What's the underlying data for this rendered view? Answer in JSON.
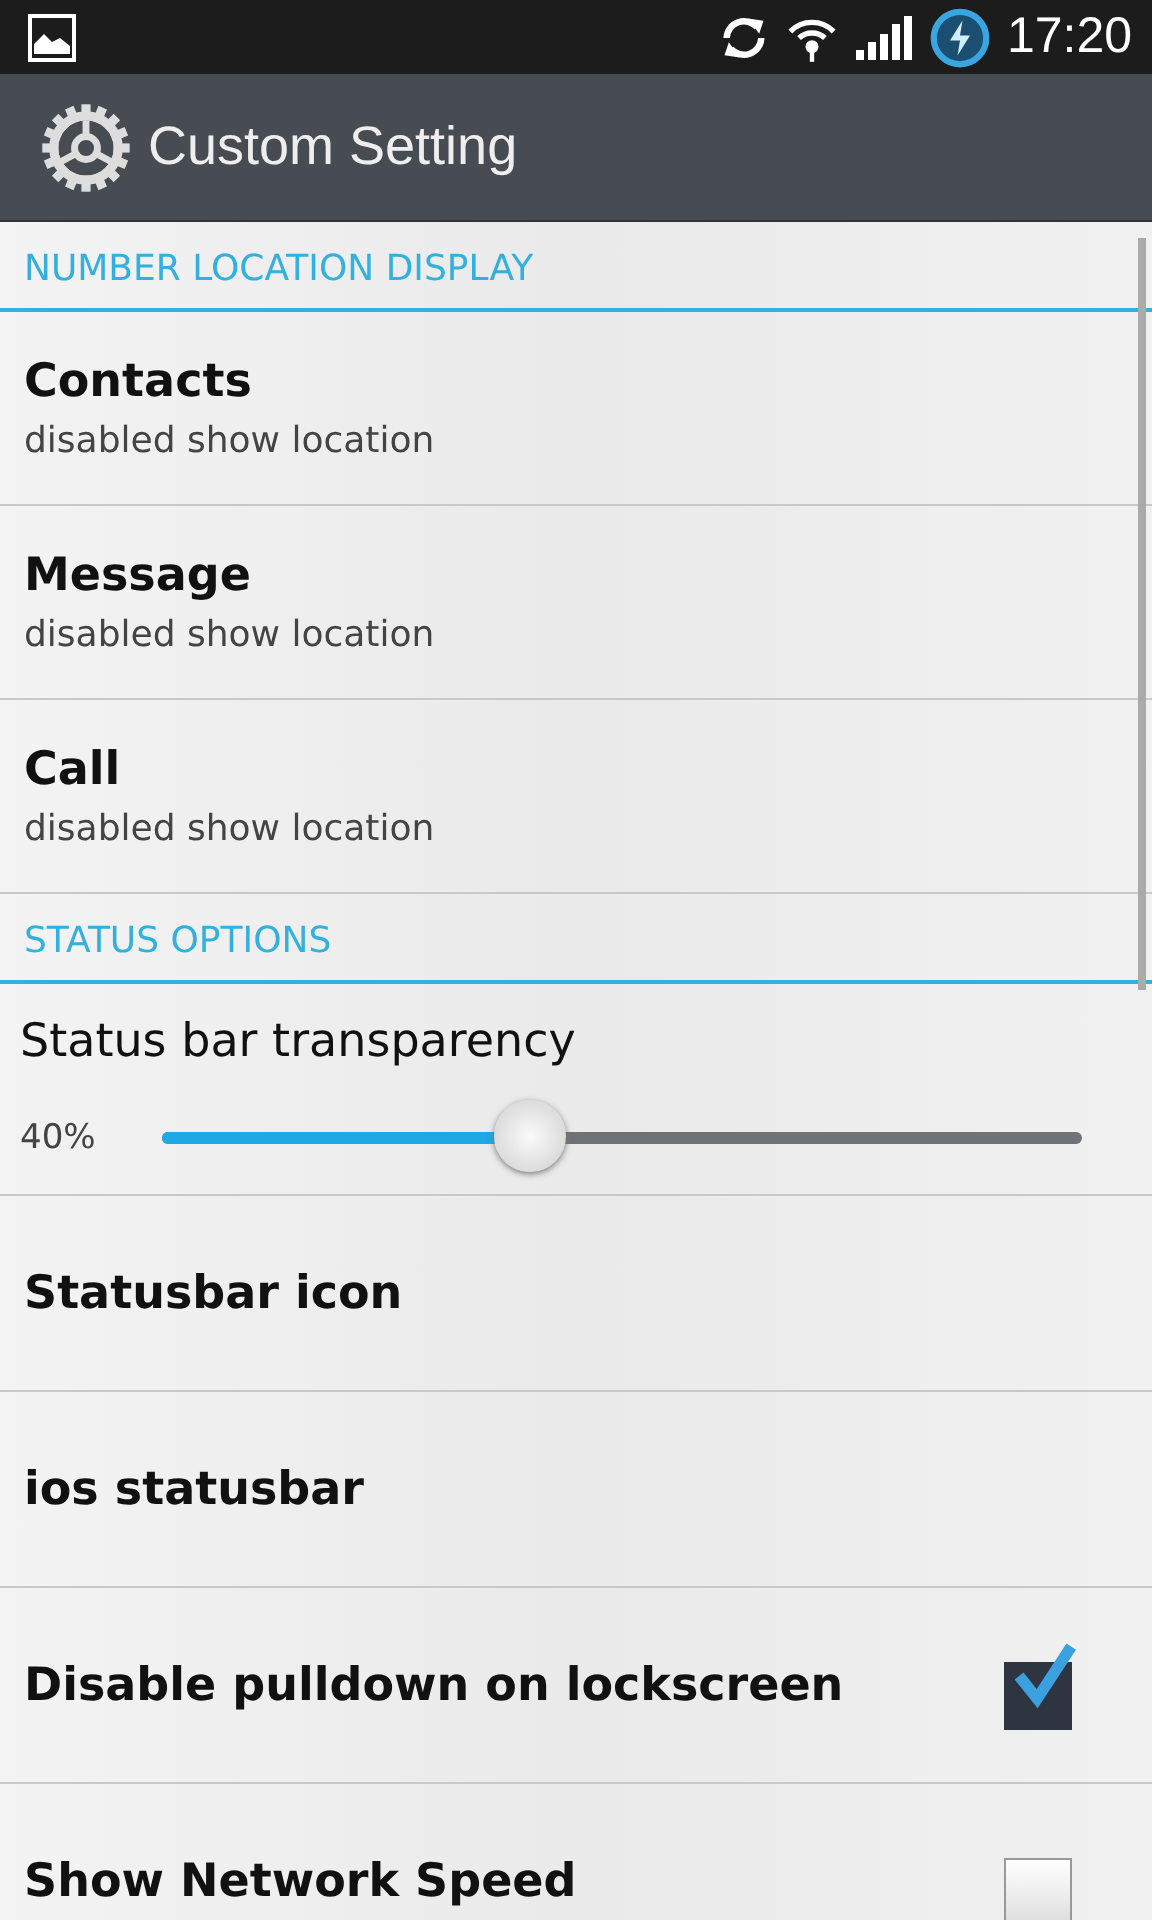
{
  "status_bar": {
    "time": "17:20"
  },
  "action_bar": {
    "title": "Custom Setting"
  },
  "sections": [
    {
      "header": "NUMBER LOCATION DISPLAY",
      "items": [
        {
          "kind": "subtitle",
          "title": "Contacts",
          "summary": "disabled show location"
        },
        {
          "kind": "subtitle",
          "title": "Message",
          "summary": "disabled show location"
        },
        {
          "kind": "subtitle",
          "title": "Call",
          "summary": "disabled show location"
        }
      ]
    },
    {
      "header": "STATUS OPTIONS",
      "items": [
        {
          "kind": "slider",
          "title": "Status bar transparency",
          "reading": "40%",
          "level": 0.4
        },
        {
          "kind": "plain",
          "title": "Statusbar icon"
        },
        {
          "kind": "plain",
          "title": "ios statusbar"
        },
        {
          "kind": "checkbox",
          "title": "Disable pulldown on lockscreen",
          "checked": true
        },
        {
          "kind": "checkbox",
          "title": "Show Network Speed",
          "checked": false
        }
      ]
    }
  ]
}
